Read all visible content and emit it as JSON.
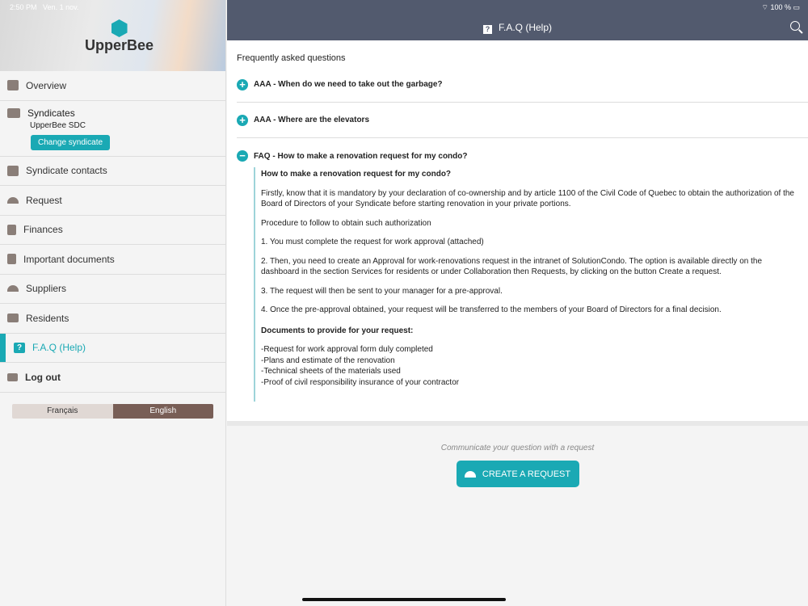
{
  "status": {
    "time": "2:50 PM",
    "date": "Ven. 1 nov.",
    "battery": "100 %"
  },
  "logo": "UpperBee",
  "nav": {
    "overview": "Overview",
    "syndicates": "Syndicates",
    "syndicate_name": "UpperBee SDC",
    "change_syndicate": "Change syndicate",
    "contacts": "Syndicate contacts",
    "request": "Request",
    "finances": "Finances",
    "documents": "Important documents",
    "suppliers": "Suppliers",
    "residents": "Residents",
    "faq": "F.A.Q (Help)",
    "logout": "Log out"
  },
  "lang": {
    "fr": "Français",
    "en": "English"
  },
  "header": {
    "title": "F.A.Q (Help)"
  },
  "faq": {
    "title": "Frequently asked questions",
    "questions": [
      "AAA - When do we need to take out the garbage?",
      "AAA - Where are the elevators",
      "FAQ - How to make a renovation request for my condo?"
    ],
    "answer": {
      "heading": "How to make a renovation request for my condo?",
      "paragraphs": [
        "Firstly, know that it is mandatory by your declaration of co-ownership and by article 1100 of the Civil Code of Quebec to obtain the authorization of the Board of Directors of your Syndicate before starting renovation in your private portions.",
        "Procedure to follow to obtain such authorization",
        "1. You must complete the request for work approval (attached)",
        "2. Then, you need to create an Approval for work-renovations request in the intranet of SolutionCondo. The option is available directly on the dashboard in the section Services for residents or under Collaboration then Requests, by clicking on the button Create a request.",
        "3. The request will then be sent to your manager for a pre-approval.",
        "4. Once the pre-approval obtained, your request will be transferred to the members of your Board of Directors for a final decision."
      ],
      "docs_heading": "Documents to provide for your request:",
      "docs": [
        "-Request for work approval form duly completed",
        "-Plans and estimate of the renovation",
        "-Technical sheets of the materials used",
        "-Proof of civil responsibility insurance of your contractor"
      ]
    }
  },
  "bottom": {
    "prompt": "Communicate your question with a request",
    "button": "CREATE A REQUEST"
  }
}
